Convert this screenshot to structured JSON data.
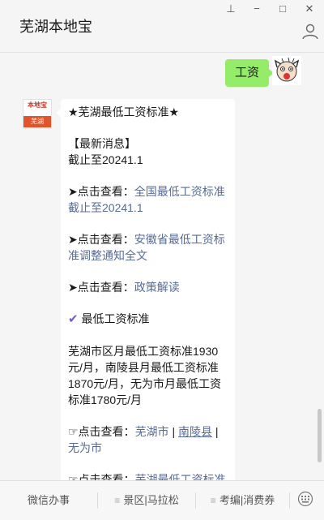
{
  "window": {
    "title": "芜湖本地宝",
    "controls": {
      "pin": "⊥",
      "minimize": "−",
      "maximize": "□",
      "close": "✕"
    }
  },
  "chat": {
    "outgoing": {
      "text": "工资"
    },
    "bot_avatar": {
      "brand": "本地宝",
      "tag": "芜湖"
    },
    "incoming": {
      "heading": "★芜湖最低工资标准★",
      "news_label": "【最新消息】",
      "news_text": "截止至20241.1",
      "item1_prefix": "➤点击查看：",
      "item1_link": "全国最低工资标准截止至20241.1",
      "item2_prefix": "➤点击查看：",
      "item2_link": "安徽省最低工资标准调整通知全文",
      "item3_prefix": "➤点击查看：",
      "item3_link": "政策解读",
      "check_mark": "✔",
      "section_title": "最低工资标准",
      "body": "芜湖市区月最低工资标准1930元/月，南陵县月最低工资标准1870元/月，无为市月最低工资标准1780元/月",
      "view_prefix": "☞点击查看：",
      "city1": "芜湖市",
      "sep": " | ",
      "city2": "南陵县",
      "city3": "无为市",
      "view2_prefix": "☞点击查看：",
      "view2_link": "芜湖最低工资标准包括五险一金吗?"
    }
  },
  "menu": {
    "items": [
      {
        "label": "微信办事",
        "glyph": ""
      },
      {
        "label": "景区|马拉松",
        "glyph": "≡"
      },
      {
        "label": "考编|消费券",
        "glyph": "≡"
      }
    ]
  },
  "colors": {
    "link": "#576b95",
    "outgoing_bubble": "#95ec69",
    "check": "#6a5fd0"
  }
}
